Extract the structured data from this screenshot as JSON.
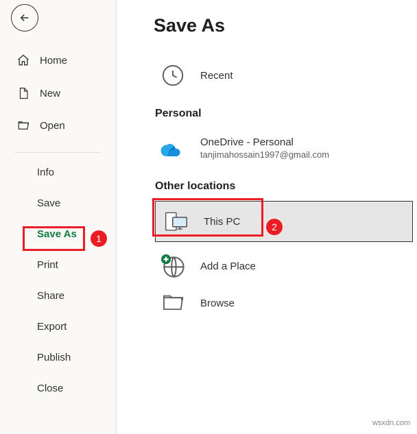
{
  "sidebar": {
    "primary": [
      {
        "label": "Home"
      },
      {
        "label": "New"
      },
      {
        "label": "Open"
      }
    ],
    "secondary": [
      {
        "label": "Info"
      },
      {
        "label": "Save"
      },
      {
        "label": "Save As"
      },
      {
        "label": "Print"
      },
      {
        "label": "Share"
      },
      {
        "label": "Export"
      },
      {
        "label": "Publish"
      },
      {
        "label": "Close"
      }
    ]
  },
  "main": {
    "title": "Save As",
    "recent_label": "Recent",
    "personal_heading": "Personal",
    "onedrive": {
      "title": "OneDrive - Personal",
      "email": "tanjimahossain1997@gmail.com"
    },
    "other_heading": "Other locations",
    "this_pc_label": "This PC",
    "add_place_label": "Add a Place",
    "browse_label": "Browse"
  },
  "annotations": {
    "badge1": "1",
    "badge2": "2"
  },
  "watermark": "wsxdn.com"
}
